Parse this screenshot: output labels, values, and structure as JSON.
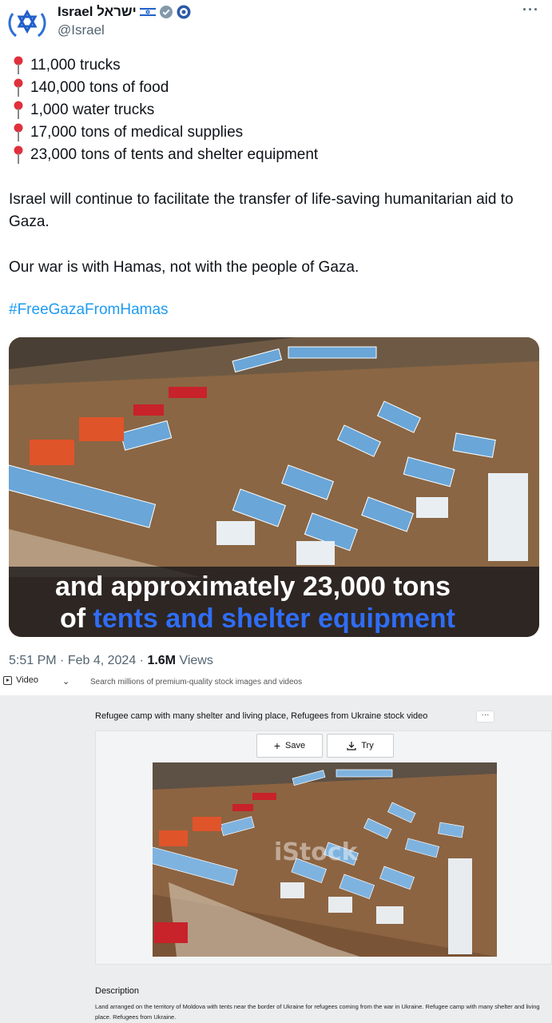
{
  "tweet": {
    "display_name": "Israel ישראל",
    "handle": "@Israel",
    "more_label": "···",
    "facts": [
      "11,000 trucks",
      "140,000 tons of food",
      "1,000 water trucks",
      "17,000 tons of medical supplies",
      "23,000 tons of tents and shelter equipment"
    ],
    "paragraph_1": "Israel will continue to facilitate the transfer of life-saving humanitarian aid to Gaza.",
    "paragraph_2": "Our war is with Hamas, not with the people of Gaza.",
    "hashtag": "#FreeGazaFromHamas",
    "video_caption_line1": "and approximately 23,000 tons",
    "video_caption_line2_prefix": "of ",
    "video_caption_line2_highlight": "tents and shelter equipment",
    "time": "5:51 PM",
    "date": "Feb 4, 2024",
    "views_count": "1.6M",
    "views_label": "Views",
    "icons": {
      "avatar": "star-of-david-icon",
      "flag": "israel-flag-icon",
      "badge": "verified-gray-badge-icon",
      "pin": "round-pushpin-icon"
    },
    "colors": {
      "hashtag": "#1d9bf0",
      "caption_highlight": "#2f6df5",
      "muted": "#536471"
    }
  },
  "search_bar": {
    "filter_label": "Video",
    "chevron": "⌄",
    "placeholder": "Search millions of premium-quality stock images and videos"
  },
  "istock": {
    "title": "Refugee camp with many shelter and living place, Refugees from Ukraine stock video",
    "more_label": "···",
    "save_label": "Save",
    "try_label": "Try",
    "watermark": "iStock",
    "description_label": "Description",
    "description_text": "Land arranged on the territory of Moldova with tents near the border of Ukraine for refugees coming from the war in Ukraine. Refugee camp with many shelter and living place. Refugees from Ukraine."
  }
}
